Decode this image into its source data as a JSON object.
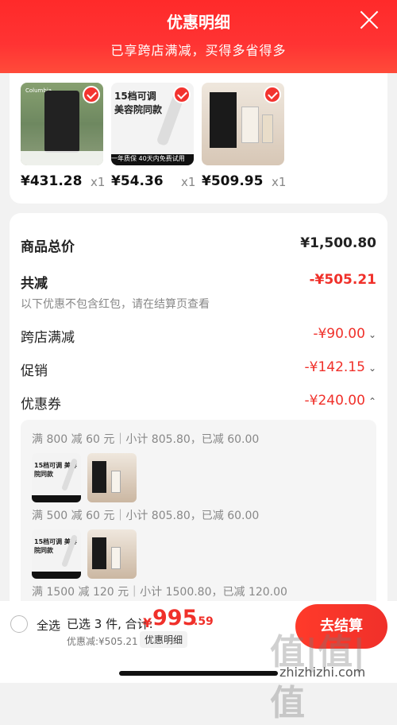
{
  "header": {
    "title": "优惠明细",
    "subtitle": "已享跨店满减，买得多省得多"
  },
  "products": [
    {
      "price": "¥431.28",
      "qty": "x1",
      "thumb_logo": "Columbia"
    },
    {
      "price": "¥54.36",
      "qty": "x1",
      "thumb_text": "15档可调 美容院同款",
      "thumb_band": "一年质保 40天内免费试用"
    },
    {
      "price": "¥509.95",
      "qty": "x1"
    }
  ],
  "summary": {
    "total_label": "商品总价",
    "total_value": "¥1,500.80",
    "reduce_label": "共减",
    "reduce_value": "-¥505.21",
    "reduce_note": "以下优惠不包含红包，请在结算页查看",
    "cross_store_label": "跨店满减",
    "cross_store_value": "-¥90.00",
    "promo_label": "促销",
    "promo_value": "-¥142.15",
    "coupon_label": "优惠券",
    "coupon_value": "-¥240.00"
  },
  "coupons": [
    {
      "text": "满 800 减 60 元｜小计 805.80，已减 60.00"
    },
    {
      "text": "满 500 减 60 元｜小计 805.80，已减 60.00"
    },
    {
      "text": "满 1500 减 120 元｜小计 1500.80，已减 120.00"
    }
  ],
  "footer": {
    "select_all": "全选",
    "selected_text": "已选 3 件, 合计:",
    "total_symbol": "¥",
    "total_int": "995",
    "total_dec": ".59",
    "discount_text": "优惠减:¥505.21",
    "detail_button": "优惠明细",
    "checkout_button": "去结算",
    "watermark": "值|值|值",
    "watermark_url": "zhizhizhi.com"
  },
  "colors": {
    "accent": "#f0302a",
    "header": "#ff2a2a"
  }
}
